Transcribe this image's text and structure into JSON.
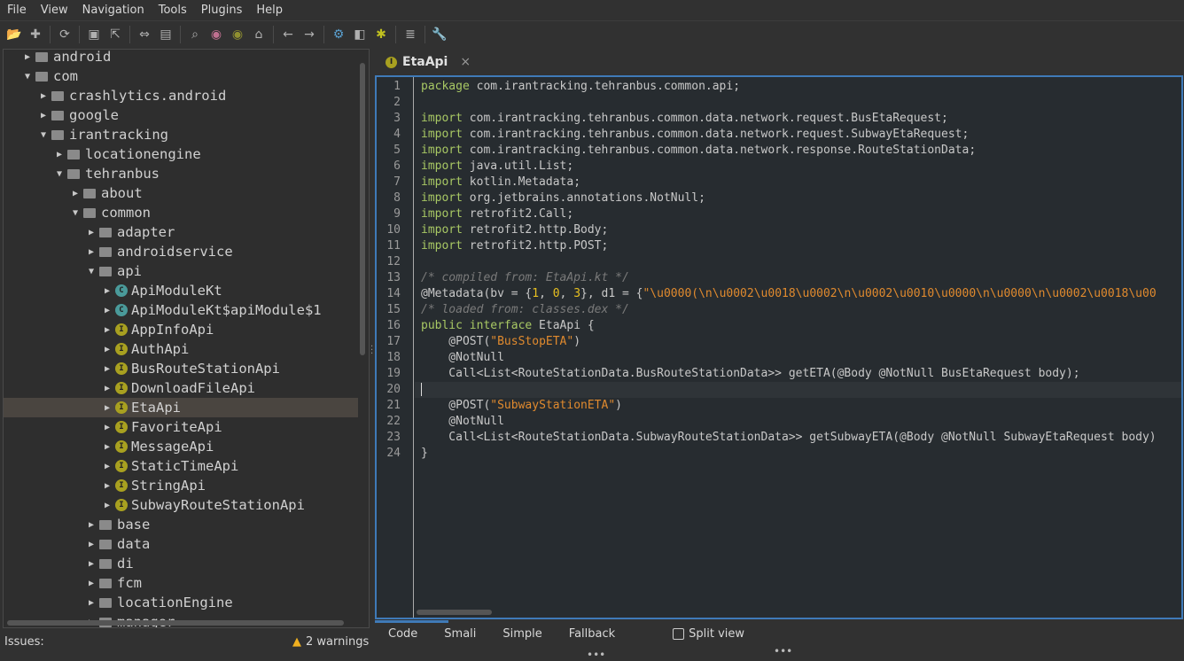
{
  "menu": [
    "File",
    "View",
    "Navigation",
    "Tools",
    "Plugins",
    "Help"
  ],
  "toolbar_icons": [
    "open-folder-icon",
    "add-files-icon",
    "|",
    "refresh-icon",
    "|",
    "save-icon",
    "export-icon",
    "|",
    "sync-tree-icon",
    "flatten-packages-icon",
    "|",
    "search-icon",
    "class-search-icon",
    "usage-search-icon",
    "home-icon",
    "|",
    "back-icon",
    "forward-icon",
    "|",
    "deobfuscation-icon",
    "smali-icon",
    "debug-icon",
    "|",
    "log-icon",
    "|",
    "preferences-icon"
  ],
  "tree": [
    {
      "label": "android",
      "depth": 0,
      "type": "folder",
      "open": false
    },
    {
      "label": "com",
      "depth": 0,
      "type": "folder",
      "open": true
    },
    {
      "label": "crashlytics.android",
      "depth": 1,
      "type": "folder",
      "open": false
    },
    {
      "label": "google",
      "depth": 1,
      "type": "folder",
      "open": false
    },
    {
      "label": "irantracking",
      "depth": 1,
      "type": "folder",
      "open": true
    },
    {
      "label": "locationengine",
      "depth": 2,
      "type": "folder",
      "open": false
    },
    {
      "label": "tehranbus",
      "depth": 2,
      "type": "folder",
      "open": true
    },
    {
      "label": "about",
      "depth": 3,
      "type": "folder",
      "open": false
    },
    {
      "label": "common",
      "depth": 3,
      "type": "folder",
      "open": true
    },
    {
      "label": "adapter",
      "depth": 4,
      "type": "folder",
      "open": false
    },
    {
      "label": "androidservice",
      "depth": 4,
      "type": "folder",
      "open": false
    },
    {
      "label": "api",
      "depth": 4,
      "type": "folder",
      "open": true
    },
    {
      "label": "ApiModuleKt",
      "depth": 5,
      "type": "class",
      "open": false
    },
    {
      "label": "ApiModuleKt$apiModule$1",
      "depth": 5,
      "type": "class",
      "open": false
    },
    {
      "label": "AppInfoApi",
      "depth": 5,
      "type": "interface",
      "open": false
    },
    {
      "label": "AuthApi",
      "depth": 5,
      "type": "interface",
      "open": false
    },
    {
      "label": "BusRouteStationApi",
      "depth": 5,
      "type": "interface",
      "open": false
    },
    {
      "label": "DownloadFileApi",
      "depth": 5,
      "type": "interface",
      "open": false
    },
    {
      "label": "EtaApi",
      "depth": 5,
      "type": "interface",
      "open": false,
      "selected": true
    },
    {
      "label": "FavoriteApi",
      "depth": 5,
      "type": "interface",
      "open": false
    },
    {
      "label": "MessageApi",
      "depth": 5,
      "type": "interface",
      "open": false
    },
    {
      "label": "StaticTimeApi",
      "depth": 5,
      "type": "interface",
      "open": false
    },
    {
      "label": "StringApi",
      "depth": 5,
      "type": "interface",
      "open": false
    },
    {
      "label": "SubwayRouteStationApi",
      "depth": 5,
      "type": "interface",
      "open": false
    },
    {
      "label": "base",
      "depth": 4,
      "type": "folder",
      "open": false
    },
    {
      "label": "data",
      "depth": 4,
      "type": "folder",
      "open": false
    },
    {
      "label": "di",
      "depth": 4,
      "type": "folder",
      "open": false
    },
    {
      "label": "fcm",
      "depth": 4,
      "type": "folder",
      "open": false
    },
    {
      "label": "locationEngine",
      "depth": 4,
      "type": "folder",
      "open": false
    },
    {
      "label": "manager",
      "depth": 4,
      "type": "folder",
      "open": false
    }
  ],
  "tab": {
    "label": "EtaApi",
    "close": "×"
  },
  "code": [
    [
      [
        "kw",
        "package"
      ],
      [
        "pl",
        " com.irantracking.tehranbus.common.api;"
      ]
    ],
    [],
    [
      [
        "kw",
        "import"
      ],
      [
        "pl",
        " com.irantracking.tehranbus.common.data.network.request.BusEtaRequest;"
      ]
    ],
    [
      [
        "kw",
        "import"
      ],
      [
        "pl",
        " com.irantracking.tehranbus.common.data.network.request.SubwayEtaRequest;"
      ]
    ],
    [
      [
        "kw",
        "import"
      ],
      [
        "pl",
        " com.irantracking.tehranbus.common.data.network.response.RouteStationData;"
      ]
    ],
    [
      [
        "kw",
        "import"
      ],
      [
        "pl",
        " java.util.List;"
      ]
    ],
    [
      [
        "kw",
        "import"
      ],
      [
        "pl",
        " kotlin.Metadata;"
      ]
    ],
    [
      [
        "kw",
        "import"
      ],
      [
        "pl",
        " org.jetbrains.annotations.NotNull;"
      ]
    ],
    [
      [
        "kw",
        "import"
      ],
      [
        "pl",
        " retrofit2.Call;"
      ]
    ],
    [
      [
        "kw",
        "import"
      ],
      [
        "pl",
        " retrofit2.http.Body;"
      ]
    ],
    [
      [
        "kw",
        "import"
      ],
      [
        "pl",
        " retrofit2.http.POST;"
      ]
    ],
    [],
    [
      [
        "cm",
        "/* compiled from: EtaApi.kt */"
      ]
    ],
    [
      [
        "pl",
        "@Metadata(bv = {"
      ],
      [
        "num",
        "1"
      ],
      [
        "pl",
        ", "
      ],
      [
        "num",
        "0"
      ],
      [
        "pl",
        ", "
      ],
      [
        "num",
        "3"
      ],
      [
        "pl",
        "}, d1 = {"
      ],
      [
        "str",
        "\"\\u0000(\\n\\u0002\\u0018\\u0002\\n\\u0002\\u0010\\u0000\\n\\u0000\\n\\u0002\\u0018\\u00"
      ]
    ],
    [
      [
        "cm",
        "/* loaded from: classes.dex */"
      ]
    ],
    [
      [
        "kw",
        "public interface"
      ],
      [
        "pl",
        " EtaApi {"
      ]
    ],
    [
      [
        "pl",
        "    @POST("
      ],
      [
        "str",
        "\"BusStopETA\""
      ],
      [
        "pl",
        ")"
      ]
    ],
    [
      [
        "pl",
        "    @NotNull"
      ]
    ],
    [
      [
        "pl",
        "    Call<List<RouteStationData.BusRouteStationData>> getETA(@Body @NotNull BusEtaRequest body);"
      ]
    ],
    [],
    [
      [
        "pl",
        "    @POST("
      ],
      [
        "str",
        "\"SubwayStationETA\""
      ],
      [
        "pl",
        ")"
      ]
    ],
    [
      [
        "pl",
        "    @NotNull"
      ]
    ],
    [
      [
        "pl",
        "    Call<List<RouteStationData.SubwayRouteStationData>> getSubwayETA(@Body @NotNull SubwayEtaRequest body)"
      ]
    ],
    [
      [
        "pl",
        "}"
      ]
    ]
  ],
  "view_tabs": [
    "Code",
    "Smali",
    "Simple",
    "Fallback"
  ],
  "split_view": "Split view",
  "status": {
    "issues": "Issues:",
    "warnings": "2 warnings"
  },
  "colors": {
    "accent": "#3f7ab8",
    "keyword": "#a8c864",
    "string": "#e08a2e",
    "number": "#e8c020",
    "interface_icon": "#a8a020",
    "class_icon": "#4a9a9a"
  }
}
